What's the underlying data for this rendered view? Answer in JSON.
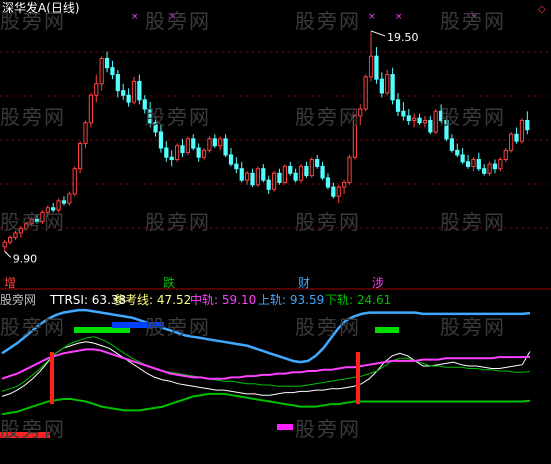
{
  "header": {
    "title": "深华发A(日线)"
  },
  "watermark": "股旁网",
  "colors": {
    "up": "#ff4040",
    "down": "#54ffff",
    "grid": "#8b0000",
    "ttrsi": "#ffffff",
    "ref": "#00c000",
    "mid": "#ff40ff",
    "upper": "#40a8ff",
    "lower": "#00c000",
    "signal": "#ff2020"
  },
  "price_chart": {
    "type": "candlestick",
    "ylim": [
      9.0,
      20.5
    ],
    "high_label": "19.50",
    "low_label": "9.90",
    "events": [
      {
        "label": "增",
        "index": 0,
        "color": "#ff4040"
      },
      {
        "label": "跌",
        "index": 31,
        "color": "#00c000"
      },
      {
        "label": "财",
        "index": 56,
        "color": "#40a8ff"
      },
      {
        "label": "涉",
        "index": 70,
        "color": "#ff40ff"
      }
    ]
  },
  "indicator": {
    "labels": [
      {
        "text": "股旁网",
        "color": "#c0c0c0"
      },
      {
        "text": "TTRSI: 63.38",
        "color": "#ffffff"
      },
      {
        "text": "参考线: 47.52",
        "color": "#ffff80"
      },
      {
        "text": "中轨: 59.10",
        "color": "#ff40ff"
      },
      {
        "text": "上轨: 93.59",
        "color": "#40a8ff"
      },
      {
        "text": "下轨: 24.61",
        "color": "#00c000"
      }
    ]
  },
  "chart_data": [
    {
      "type": "candlestick",
      "ylim": [
        9.0,
        20.5
      ],
      "high": 19.5,
      "low": 9.9,
      "ohlc": [
        [
          10.1,
          10.4,
          9.9,
          10.3
        ],
        [
          10.3,
          10.6,
          10.2,
          10.5
        ],
        [
          10.5,
          10.8,
          10.4,
          10.7
        ],
        [
          10.7,
          11.0,
          10.5,
          10.9
        ],
        [
          10.9,
          11.2,
          10.8,
          11.1
        ],
        [
          11.1,
          11.4,
          11.0,
          11.3
        ],
        [
          11.3,
          11.5,
          11.1,
          11.2
        ],
        [
          11.2,
          11.7,
          11.1,
          11.6
        ],
        [
          11.6,
          11.9,
          11.4,
          11.8
        ],
        [
          11.8,
          12.0,
          11.6,
          11.7
        ],
        [
          11.7,
          12.2,
          11.6,
          12.1
        ],
        [
          12.1,
          12.3,
          11.9,
          12.0
        ],
        [
          12.0,
          12.5,
          11.9,
          12.4
        ],
        [
          12.4,
          13.6,
          12.3,
          13.5
        ],
        [
          13.5,
          14.7,
          13.3,
          14.6
        ],
        [
          14.6,
          15.6,
          14.4,
          15.5
        ],
        [
          15.5,
          16.8,
          15.3,
          16.7
        ],
        [
          16.7,
          17.6,
          16.4,
          17.2
        ],
        [
          17.2,
          18.4,
          16.9,
          18.3
        ],
        [
          18.3,
          18.6,
          17.7,
          17.9
        ],
        [
          17.9,
          18.2,
          17.4,
          17.6
        ],
        [
          17.6,
          17.8,
          16.6,
          16.9
        ],
        [
          16.9,
          17.2,
          16.5,
          16.7
        ],
        [
          16.7,
          17.0,
          16.2,
          16.4
        ],
        [
          16.4,
          17.5,
          16.3,
          17.3
        ],
        [
          17.3,
          17.6,
          16.3,
          16.5
        ],
        [
          16.5,
          16.7,
          15.9,
          16.1
        ],
        [
          16.1,
          16.4,
          15.3,
          15.5
        ],
        [
          15.5,
          15.8,
          14.9,
          15.1
        ],
        [
          15.1,
          15.4,
          14.2,
          14.4
        ],
        [
          14.4,
          14.7,
          13.8,
          14.0
        ],
        [
          14.0,
          14.3,
          13.6,
          13.9
        ],
        [
          13.9,
          14.6,
          13.8,
          14.5
        ],
        [
          14.5,
          14.8,
          14.0,
          14.2
        ],
        [
          14.2,
          14.9,
          14.1,
          14.8
        ],
        [
          14.8,
          15.0,
          14.3,
          14.4
        ],
        [
          14.4,
          14.6,
          13.8,
          14.0
        ],
        [
          14.0,
          14.4,
          13.9,
          14.3
        ],
        [
          14.3,
          14.9,
          14.2,
          14.8
        ],
        [
          14.8,
          15.0,
          14.4,
          14.5
        ],
        [
          14.5,
          14.9,
          14.3,
          14.8
        ],
        [
          14.8,
          15.0,
          14.0,
          14.1
        ],
        [
          14.1,
          14.4,
          13.6,
          13.7
        ],
        [
          13.7,
          14.0,
          13.3,
          13.5
        ],
        [
          13.5,
          13.8,
          12.9,
          13.0
        ],
        [
          13.0,
          13.4,
          12.8,
          13.3
        ],
        [
          13.3,
          13.5,
          12.7,
          12.8
        ],
        [
          12.8,
          13.6,
          12.7,
          13.5
        ],
        [
          13.5,
          13.7,
          12.9,
          13.0
        ],
        [
          13.0,
          13.2,
          12.4,
          12.6
        ],
        [
          12.6,
          13.4,
          12.5,
          13.3
        ],
        [
          13.3,
          13.5,
          12.8,
          12.9
        ],
        [
          12.9,
          13.7,
          12.8,
          13.6
        ],
        [
          13.6,
          13.8,
          13.2,
          13.3
        ],
        [
          13.3,
          13.5,
          12.9,
          13.0
        ],
        [
          13.0,
          13.7,
          12.9,
          13.6
        ],
        [
          13.6,
          13.8,
          13.1,
          13.2
        ],
        [
          13.2,
          14.0,
          13.1,
          13.9
        ],
        [
          13.9,
          14.1,
          13.5,
          13.6
        ],
        [
          13.6,
          13.8,
          13.0,
          13.1
        ],
        [
          13.1,
          13.3,
          12.6,
          12.7
        ],
        [
          12.7,
          12.9,
          12.2,
          12.3
        ],
        [
          12.3,
          12.8,
          12.0,
          12.7
        ],
        [
          12.7,
          13.0,
          12.4,
          12.9
        ],
        [
          12.9,
          14.1,
          12.8,
          14.0
        ],
        [
          14.0,
          15.9,
          13.9,
          15.8
        ],
        [
          15.8,
          16.3,
          15.4,
          16.1
        ],
        [
          16.1,
          17.6,
          16.0,
          17.5
        ],
        [
          17.5,
          19.5,
          17.3,
          18.4
        ],
        [
          18.4,
          18.8,
          17.2,
          17.4
        ],
        [
          17.4,
          17.7,
          16.6,
          16.8
        ],
        [
          16.8,
          17.8,
          16.7,
          17.6
        ],
        [
          17.6,
          17.9,
          16.3,
          16.5
        ],
        [
          16.5,
          16.8,
          15.8,
          16.0
        ],
        [
          16.0,
          16.4,
          15.6,
          15.8
        ],
        [
          15.8,
          16.1,
          15.4,
          15.6
        ],
        [
          15.6,
          15.9,
          15.3,
          15.7
        ],
        [
          15.7,
          15.9,
          15.4,
          15.5
        ],
        [
          15.5,
          15.8,
          15.3,
          15.6
        ],
        [
          15.6,
          15.8,
          15.0,
          15.1
        ],
        [
          15.1,
          16.1,
          15.0,
          16.0
        ],
        [
          16.0,
          16.3,
          15.5,
          15.6
        ],
        [
          15.6,
          15.8,
          14.7,
          14.8
        ],
        [
          14.8,
          15.0,
          14.2,
          14.3
        ],
        [
          14.3,
          14.6,
          14.0,
          14.1
        ],
        [
          14.1,
          14.4,
          13.7,
          13.8
        ],
        [
          13.8,
          14.1,
          13.5,
          13.6
        ],
        [
          13.6,
          14.0,
          13.4,
          13.9
        ],
        [
          13.9,
          14.2,
          13.4,
          13.5
        ],
        [
          13.5,
          13.7,
          13.2,
          13.3
        ],
        [
          13.3,
          13.8,
          13.2,
          13.7
        ],
        [
          13.7,
          13.9,
          13.3,
          13.5
        ],
        [
          13.5,
          14.0,
          13.4,
          13.9
        ],
        [
          13.9,
          14.4,
          13.8,
          14.3
        ],
        [
          14.3,
          15.1,
          14.2,
          15.0
        ],
        [
          15.0,
          15.3,
          14.6,
          14.7
        ],
        [
          14.7,
          15.7,
          14.6,
          15.6
        ],
        [
          15.6,
          16.0,
          15.0,
          15.2
        ]
      ]
    },
    {
      "type": "line",
      "title": "TTRSI",
      "ylim": [
        0,
        100
      ],
      "series": [
        {
          "name": "TTRSI",
          "color": "#ffffff",
          "values": [
            28,
            30,
            33,
            37,
            42,
            48,
            55,
            62,
            66,
            68,
            70,
            71,
            70,
            68,
            66,
            62,
            58,
            54,
            50,
            46,
            43,
            41,
            40,
            38,
            37,
            36,
            35,
            34,
            33,
            33,
            32,
            31,
            30,
            30,
            29,
            29,
            30,
            31,
            31,
            32,
            32,
            33,
            33,
            34,
            34,
            35,
            36,
            38,
            42,
            48,
            55,
            60,
            62,
            60,
            56,
            52,
            52,
            53,
            54,
            55,
            53,
            52,
            52,
            51,
            50,
            50,
            51,
            52,
            53,
            63.38
          ]
        },
        {
          "name": "参考线",
          "color": "#00c000",
          "values": [
            32,
            34,
            36,
            40,
            45,
            50,
            56,
            62,
            66,
            70,
            72,
            74,
            75,
            73,
            70,
            66,
            62,
            58,
            55,
            52,
            50,
            48,
            47,
            46,
            45,
            44,
            43,
            42,
            41,
            40,
            40,
            39,
            38,
            38,
            37,
            37,
            36,
            36,
            36,
            36,
            37,
            38,
            39,
            40,
            41,
            42,
            43,
            44,
            46,
            48,
            52,
            56,
            58,
            58,
            56,
            54,
            52,
            52,
            51,
            51,
            51,
            50,
            50,
            49,
            49,
            48,
            48,
            47,
            47,
            47.52
          ]
        },
        {
          "name": "中轨",
          "color": "#ff40ff",
          "values": [
            42,
            44,
            46,
            49,
            52,
            55,
            58,
            60,
            62,
            63,
            64,
            65,
            65,
            64,
            62,
            60,
            58,
            56,
            54,
            52,
            50,
            48,
            46,
            45,
            44,
            43,
            43,
            42,
            42,
            42,
            43,
            43,
            44,
            44,
            45,
            45,
            46,
            46,
            47,
            47,
            48,
            48,
            49,
            49,
            50,
            51,
            51,
            52,
            53,
            54,
            55,
            56,
            56,
            56,
            56,
            57,
            57,
            57,
            58,
            58,
            58,
            58,
            58,
            58,
            58,
            59,
            59,
            59,
            59,
            59.1
          ]
        },
        {
          "name": "上轨",
          "color": "#40a8ff",
          "values": [
            62,
            66,
            70,
            75,
            80,
            85,
            89,
            92,
            94,
            95,
            96,
            96,
            95,
            94,
            93,
            92,
            91,
            90,
            88,
            86,
            84,
            82,
            80,
            78,
            76,
            75,
            74,
            73,
            72,
            71,
            70,
            69,
            68,
            66,
            64,
            62,
            60,
            58,
            56,
            55,
            56,
            60,
            66,
            74,
            82,
            88,
            91,
            93,
            94,
            94,
            94,
            94,
            94,
            94,
            94,
            93,
            93,
            93,
            93,
            93,
            93,
            93,
            93,
            93,
            93,
            93,
            93,
            93,
            93,
            93.59
          ]
        },
        {
          "name": "下轨",
          "color": "#00c000",
          "values": [
            14,
            15,
            16,
            18,
            20,
            22,
            24,
            25,
            26,
            26,
            25,
            24,
            22,
            20,
            19,
            18,
            17,
            17,
            17,
            18,
            19,
            20,
            22,
            24,
            26,
            28,
            29,
            30,
            30,
            30,
            29,
            28,
            27,
            26,
            25,
            24,
            23,
            22,
            21,
            20,
            20,
            20,
            21,
            22,
            22,
            23,
            24,
            24,
            24,
            24,
            24,
            24,
            24,
            24,
            24,
            24,
            24,
            24,
            24,
            24,
            24,
            24,
            24,
            24,
            24,
            24,
            24,
            24,
            24,
            24.61
          ]
        }
      ]
    }
  ]
}
